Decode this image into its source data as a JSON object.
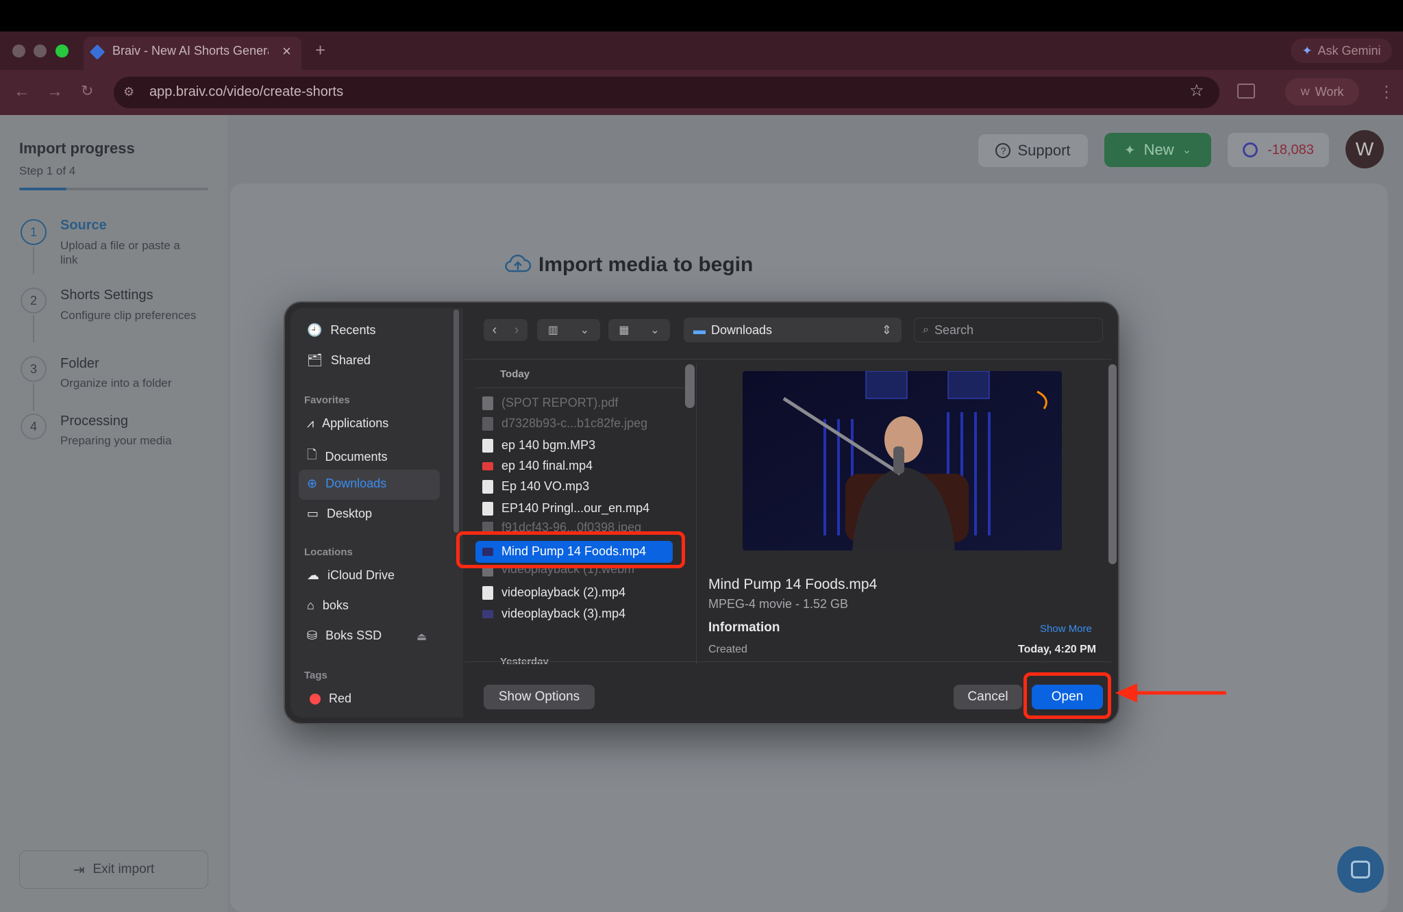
{
  "browser": {
    "tab_title": "Braiv - New AI Shorts Genera",
    "url": "app.braiv.co/video/create-shorts",
    "ask_gemini": "Ask Gemini",
    "profile_initial": "W",
    "profile_label": "Work"
  },
  "header": {
    "support_label": "Support",
    "new_label": "New",
    "credits": "-18,083",
    "avatar_initial": "W"
  },
  "progress": {
    "title": "Import progress",
    "step_text": "Step 1 of 4",
    "fraction": 0.25,
    "steps": [
      {
        "num": "1",
        "title": "Source",
        "desc": "Upload a file or paste a link"
      },
      {
        "num": "2",
        "title": "Shorts Settings",
        "desc": "Configure clip preferences"
      },
      {
        "num": "3",
        "title": "Folder",
        "desc": "Organize into a folder"
      },
      {
        "num": "4",
        "title": "Processing",
        "desc": "Preparing your media"
      }
    ],
    "exit_label": "Exit import"
  },
  "main": {
    "import_title": "Import media to begin"
  },
  "dialog": {
    "sidebar": {
      "recents": "Recents",
      "shared": "Shared",
      "favorites_header": "Favorites",
      "favorites": [
        "Applications",
        "Documents",
        "Downloads",
        "Desktop"
      ],
      "locations_header": "Locations",
      "locations": [
        "iCloud Drive",
        "boks",
        "Boks SSD"
      ],
      "tags_header": "Tags",
      "tags": [
        "Red"
      ]
    },
    "location": "Downloads",
    "search_placeholder": "Search",
    "group_today": "Today",
    "group_yesterday": "Yesterday",
    "files": [
      "(SPOT REPORT).pdf",
      "d7328b93-c...b1c82fe.jpeg",
      "ep 140 bgm.MP3",
      "ep 140 final.mp4",
      "Ep 140 VO.mp3",
      "EP140 Pringl...our_en.mp4",
      "f91dcf43-96...0f0398.jpeg",
      "Mind Pump 14 Foods.mp4",
      "videoplayback (1).webm",
      "videoplayback (2).mp4",
      "videoplayback (3).mp4"
    ],
    "preview": {
      "name": "Mind Pump 14 Foods.mp4",
      "kind": "MPEG-4 movie - 1.52 GB",
      "info_label": "Information",
      "show_more": "Show More",
      "created_label": "Created",
      "created_value": "Today, 4:20 PM"
    },
    "show_options": "Show Options",
    "cancel": "Cancel",
    "open": "Open"
  },
  "colors": {
    "highlight": "#ff2a12",
    "accent_blue": "#0a63e0",
    "new_green": "#2f8a55"
  }
}
